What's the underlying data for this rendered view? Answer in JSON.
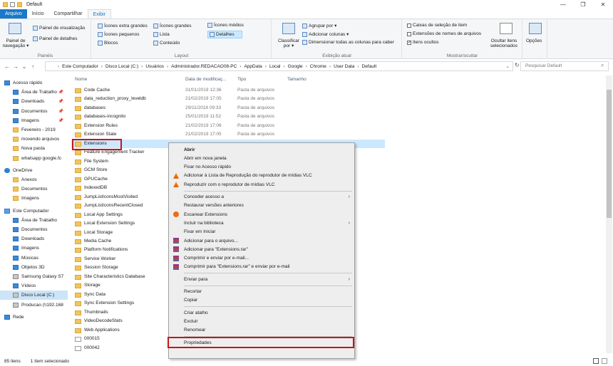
{
  "window": {
    "title": "Default",
    "minimize": "—",
    "maximize": "❐",
    "close": "✕"
  },
  "tabs": [
    "Arquivo",
    "Início",
    "Compartilhar",
    "Exibir"
  ],
  "ribbon": {
    "panels_group": {
      "label": "Painéis",
      "nav_pane": "Painel de navegação ▾",
      "preview": "Painel de visualização",
      "details": "Painel de detalhes"
    },
    "layout_group": {
      "label": "Layout",
      "items": [
        "Ícones extra grandes",
        "Ícones grandes",
        "Ícones médios",
        "Ícones pequenos",
        "Lista",
        "Detalhes",
        "Blocos",
        "Conteúdo"
      ]
    },
    "view_group": {
      "label": "Exibição atual",
      "sort": "Classificar por ▾",
      "group": "Agrupar por ▾",
      "add_cols": "Adicionar colunas ▾",
      "size_cols": "Dimensionar todas as colunas para caber"
    },
    "show_group": {
      "label": "Mostrar/ocultar",
      "checkboxes": "Caixas de seleção de item",
      "extensions": "Extensões de nomes de arquivos",
      "hidden": "Itens ocultos",
      "hide_sel": "Ocultar itens selecionados",
      "options": "Opções"
    }
  },
  "address": {
    "crumbs": [
      "Este Computador",
      "Disco Local (C:)",
      "Usuários",
      "Administrador.REDACAO08-PC",
      "AppData",
      "Local",
      "Google",
      "Chrome",
      "User Data",
      "Default"
    ],
    "search_placeholder": "Pesquisar Default"
  },
  "nav": [
    {
      "label": "Acesso rápido",
      "icon": "star"
    },
    {
      "label": "Área de Trabalho",
      "icon": "desktop",
      "pin": true
    },
    {
      "label": "Downloads",
      "icon": "download",
      "pin": true
    },
    {
      "label": "Documentos",
      "icon": "docs",
      "pin": true
    },
    {
      "label": "Imagens",
      "icon": "pictures",
      "pin": true
    },
    {
      "label": "Fevereiro - 2019",
      "icon": "folder"
    },
    {
      "label": "movendo arquivos",
      "icon": "folder"
    },
    {
      "label": "Nova pasta",
      "icon": "folder"
    },
    {
      "label": "whatsapp google.fc",
      "icon": "folder"
    },
    {
      "label": "OneDrive",
      "icon": "cloud"
    },
    {
      "label": "Anexos",
      "icon": "folder"
    },
    {
      "label": "Documentos",
      "icon": "folder"
    },
    {
      "label": "Imagens",
      "icon": "folder"
    },
    {
      "label": "Este Computador",
      "icon": "pc"
    },
    {
      "label": "Área de Trabalho",
      "icon": "desktop"
    },
    {
      "label": "Documentos",
      "icon": "docs"
    },
    {
      "label": "Downloads",
      "icon": "download"
    },
    {
      "label": "Imagens",
      "icon": "pictures"
    },
    {
      "label": "Músicas",
      "icon": "music"
    },
    {
      "label": "Objetos 3D",
      "icon": "3d"
    },
    {
      "label": "Samsung Galaxy S7",
      "icon": "phone"
    },
    {
      "label": "Vídeos",
      "icon": "video"
    },
    {
      "label": "Disco Local (C:)",
      "icon": "drive",
      "selected": true
    },
    {
      "label": "Producao (\\\\192.168",
      "icon": "netdrive"
    },
    {
      "label": "Rede",
      "icon": "network"
    }
  ],
  "columns": {
    "name": "Nome",
    "date": "Data de modificaç...",
    "type": "Tipo",
    "size": "Tamanho"
  },
  "files": [
    {
      "name": "Code Cache",
      "date": "31/01/2019 12:36",
      "type": "Pasta de arquivos"
    },
    {
      "name": "data_reduction_proxy_leveldb",
      "date": "21/02/2019 17:05",
      "type": "Pasta de arquivos"
    },
    {
      "name": "databases",
      "date": "29/11/2018 09:33",
      "type": "Pasta de arquivos"
    },
    {
      "name": "databases-incognito",
      "date": "25/01/2019 11:52",
      "type": "Pasta de arquivos"
    },
    {
      "name": "Extension Rules",
      "date": "21/02/2019 17:06",
      "type": "Pasta de arquivos"
    },
    {
      "name": "Extension State",
      "date": "21/02/2019 17:05",
      "type": "Pasta de arquivos"
    },
    {
      "name": "Extensions",
      "date": "",
      "type": "",
      "selected": true
    },
    {
      "name": "Feature Engagement Tracker",
      "date": "",
      "type": ""
    },
    {
      "name": "File System",
      "date": "",
      "type": ""
    },
    {
      "name": "GCM Store",
      "date": "",
      "type": ""
    },
    {
      "name": "GPUCache",
      "date": "",
      "type": ""
    },
    {
      "name": "IndexedDB",
      "date": "",
      "type": ""
    },
    {
      "name": "JumpListIconsMostVisited",
      "date": "",
      "type": ""
    },
    {
      "name": "JumpListIconsRecentClosed",
      "date": "",
      "type": ""
    },
    {
      "name": "Local App Settings",
      "date": "",
      "type": ""
    },
    {
      "name": "Local Extension Settings",
      "date": "",
      "type": ""
    },
    {
      "name": "Local Storage",
      "date": "",
      "type": ""
    },
    {
      "name": "Media Cache",
      "date": "",
      "type": ""
    },
    {
      "name": "Platform Notifications",
      "date": "",
      "type": ""
    },
    {
      "name": "Service Worker",
      "date": "",
      "type": ""
    },
    {
      "name": "Session Storage",
      "date": "",
      "type": ""
    },
    {
      "name": "Site Characteristics Database",
      "date": "",
      "type": ""
    },
    {
      "name": "Storage",
      "date": "",
      "type": ""
    },
    {
      "name": "Sync Data",
      "date": "",
      "type": ""
    },
    {
      "name": "Sync Extension Settings",
      "date": "",
      "type": ""
    },
    {
      "name": "Thumbnails",
      "date": "",
      "type": ""
    },
    {
      "name": "VideoDecodeStats",
      "date": "",
      "type": ""
    },
    {
      "name": "Web Applications",
      "date": "",
      "type": ""
    },
    {
      "name": "000015",
      "date": "",
      "type": "",
      "doc": true
    },
    {
      "name": "000042",
      "date": "",
      "type": "",
      "doc": true
    }
  ],
  "context_menu": [
    {
      "label": "Abrir",
      "bold": true
    },
    {
      "label": "Abrir em nova janela"
    },
    {
      "label": "Fixar no Acesso rápido"
    },
    {
      "label": "Adicionar à Lista de Reprodução do reprodutor de mídias VLC",
      "icon": "vlc"
    },
    {
      "label": "Reproduzir com o reprodutor de mídias VLC",
      "icon": "vlc"
    },
    {
      "sep": true
    },
    {
      "label": "Conceder acesso a",
      "arrow": true
    },
    {
      "label": "Restaurar versões anteriores"
    },
    {
      "label": "Escanear Extensions",
      "icon": "avast"
    },
    {
      "label": "Incluir na biblioteca",
      "arrow": true
    },
    {
      "label": "Fixar em Iniciar"
    },
    {
      "label": "Adicionar para o arquivo...",
      "icon": "rar"
    },
    {
      "label": "Adicionar para \"Extensions.rar\"",
      "icon": "rar"
    },
    {
      "label": "Comprimir e enviar por e-mail...",
      "icon": "rar"
    },
    {
      "label": "Comprimir para \"Extensions.rar\" e enviar por e-mail",
      "icon": "rar"
    },
    {
      "sep": true
    },
    {
      "label": "Enviar para",
      "arrow": true
    },
    {
      "sep": true
    },
    {
      "label": "Recortar"
    },
    {
      "label": "Copiar"
    },
    {
      "sep": true
    },
    {
      "label": "Criar atalho"
    },
    {
      "label": "Excluir"
    },
    {
      "label": "Renomear"
    },
    {
      "sep": true
    },
    {
      "label": "Propriedades",
      "highlight": true
    }
  ],
  "status": {
    "count": "85 itens",
    "selection": "1 item selecionado"
  },
  "colors": {
    "accent": "#1979ca",
    "highlight_red": "#c4161c",
    "selection": "#cce8ff"
  }
}
